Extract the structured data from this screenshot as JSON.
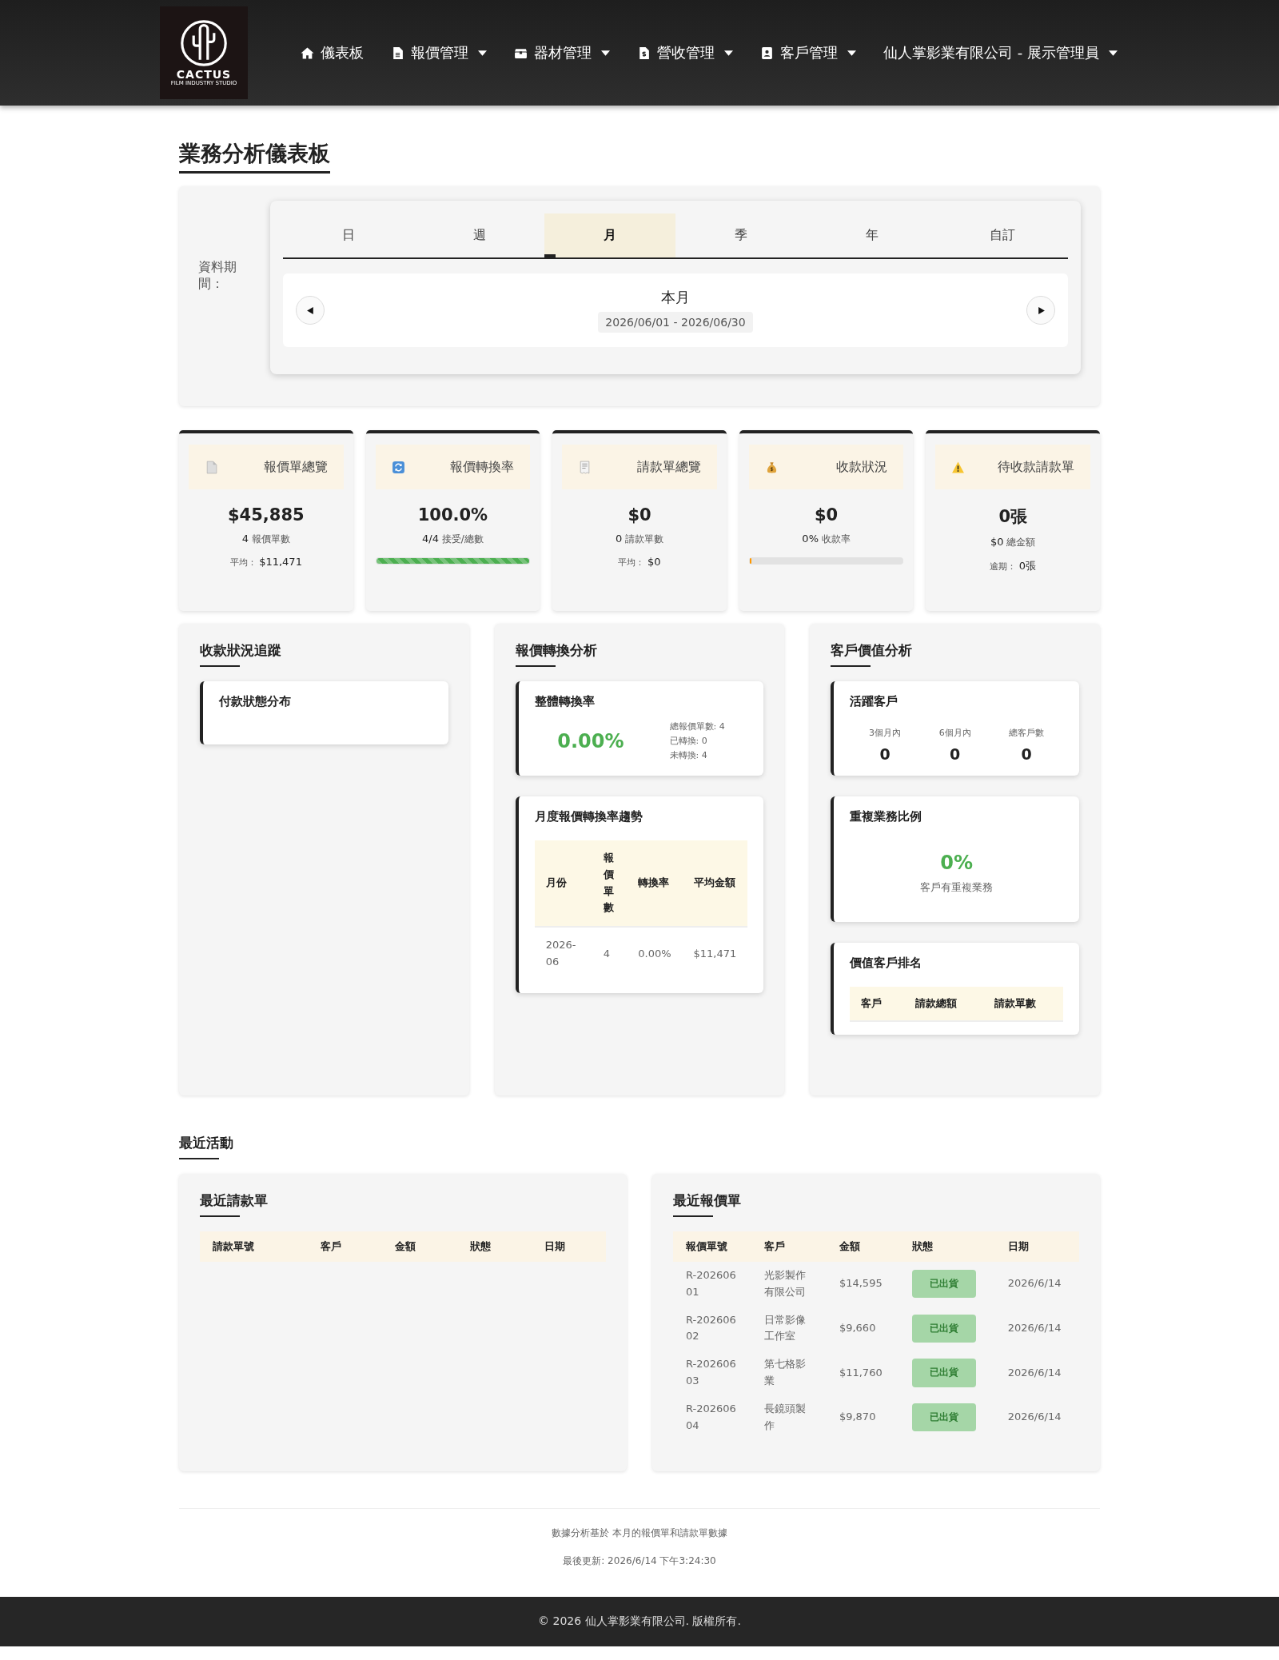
{
  "nav": {
    "logo": {
      "title": "CACTUS",
      "subtitle": "FILM INDUSTRY STUDIO"
    },
    "items": [
      {
        "label": "儀表板",
        "dropdown": false
      },
      {
        "label": "報價管理",
        "dropdown": true
      },
      {
        "label": "器材管理",
        "dropdown": true
      },
      {
        "label": "營收管理",
        "dropdown": true
      },
      {
        "label": "客戶管理",
        "dropdown": true
      }
    ],
    "user": {
      "label": "仙人掌影業有限公司 - 展示管理員",
      "dropdown": true
    }
  },
  "page_title": "業務分析儀表板",
  "period": {
    "label": "資料期間：",
    "tabs": [
      {
        "label": "日",
        "selected": false
      },
      {
        "label": "週",
        "selected": false
      },
      {
        "label": "月",
        "selected": true
      },
      {
        "label": "季",
        "selected": false
      },
      {
        "label": "年",
        "selected": false
      },
      {
        "label": "自訂",
        "selected": false
      }
    ],
    "current": "本月",
    "range": "2026/06/01 - 2026/06/30"
  },
  "kpis": [
    {
      "kind": "stats",
      "title": "報價單總覽",
      "value": "$45,885",
      "count": "4",
      "count_label": "報價單數",
      "extra_label": "平均：",
      "extra_value": "$11,471"
    },
    {
      "kind": "progress",
      "title": "報價轉換率",
      "value": "100.0%",
      "count": "4/4",
      "count_label": "接受/總數",
      "level": 1.0,
      "color": "#4caf50"
    },
    {
      "kind": "stats",
      "title": "請款單總覽",
      "value": "$0",
      "count": "0",
      "count_label": "請款單數",
      "extra_label": "平均：",
      "extra_value": "$0"
    },
    {
      "kind": "progress",
      "title": "收款狀況",
      "value": "$0",
      "count": "0%",
      "count_label": "收款率",
      "level": 0.01,
      "color": "#ff9800"
    },
    {
      "kind": "stats",
      "title": "待收款請款單",
      "value": "0張",
      "count": "$0",
      "count_label": "總金額",
      "extra_label": "逾期：",
      "extra_value": "0張"
    }
  ],
  "panels": [
    {
      "title": "收款狀況追蹤",
      "cards": [
        {
          "kind": "empty",
          "title": "付款狀態分布"
        }
      ]
    },
    {
      "title": "報價轉換分析",
      "cards": [
        {
          "kind": "rate",
          "title": "整體轉換率",
          "value": "0.00%",
          "details": [
            "總報價單數: 4",
            "已轉換: 0",
            "未轉換: 4"
          ]
        },
        {
          "kind": "table",
          "title": "月度報價轉換率趨勢",
          "columns": [
            "月份",
            "報價單數",
            "轉換率",
            "平均金額"
          ],
          "rows": [
            [
              "2026-06",
              "4",
              "0.00%",
              "$11,471"
            ]
          ]
        }
      ]
    },
    {
      "title": "客戶價值分析",
      "cards": [
        {
          "kind": "stats",
          "title": "活躍客戶",
          "stats": [
            {
              "label": "3個月內",
              "value": "0"
            },
            {
              "label": "6個月內",
              "value": "0"
            },
            {
              "label": "總客戶數",
              "value": "0"
            }
          ]
        },
        {
          "kind": "big",
          "title": "重複業務比例",
          "value": "0%",
          "caption": "客戶有重複業務"
        },
        {
          "kind": "table",
          "title": "價值客戶排名",
          "columns": [
            "客戶",
            "請款總額",
            "請款單數"
          ]
        }
      ]
    }
  ],
  "recent": {
    "title": "最近活動",
    "tables": [
      {
        "title": "最近請款單",
        "columns": [
          "請款單號",
          "客戶",
          "金額",
          "狀態",
          "日期"
        ]
      },
      {
        "title": "最近報價單",
        "columns": [
          "報價單號",
          "客戶",
          "金額",
          "狀態",
          "日期"
        ],
        "rows": [
          [
            "R-20260601",
            "光影製作有限公司",
            "$14,595",
            "已出貨",
            "2026/6/14"
          ],
          [
            "R-20260602",
            "日常影像工作室",
            "$9,660",
            "已出貨",
            "2026/6/14"
          ],
          [
            "R-20260603",
            "第七格影業",
            "$11,760",
            "已出貨",
            "2026/6/14"
          ],
          [
            "R-20260604",
            "長鏡頭製作",
            "$9,870",
            "已出貨",
            "2026/6/14"
          ]
        ]
      }
    ]
  },
  "footer": {
    "note": "數據分析基於 本月的報價單和請款單數據",
    "updated": "最後更新: 2026/6/14 下午3:24:30",
    "copyright": "© 2026 仙人掌影業有限公司. 版權所有."
  }
}
